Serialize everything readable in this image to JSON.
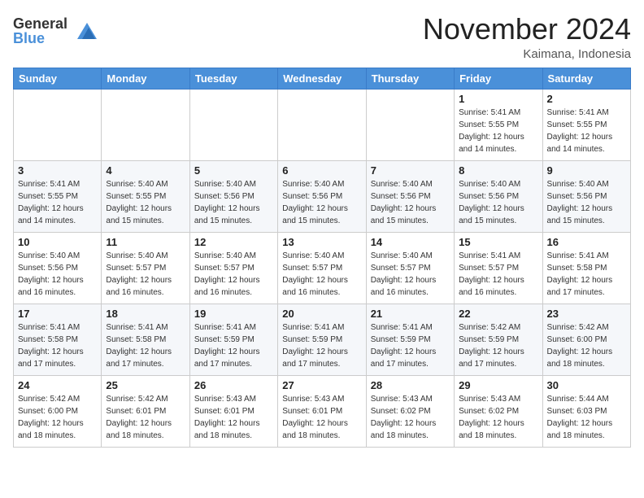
{
  "header": {
    "logo_general": "General",
    "logo_blue": "Blue",
    "month_title": "November 2024",
    "subtitle": "Kaimana, Indonesia"
  },
  "weekdays": [
    "Sunday",
    "Monday",
    "Tuesday",
    "Wednesday",
    "Thursday",
    "Friday",
    "Saturday"
  ],
  "weeks": [
    [
      {
        "day": "",
        "info": ""
      },
      {
        "day": "",
        "info": ""
      },
      {
        "day": "",
        "info": ""
      },
      {
        "day": "",
        "info": ""
      },
      {
        "day": "",
        "info": ""
      },
      {
        "day": "1",
        "info": "Sunrise: 5:41 AM\nSunset: 5:55 PM\nDaylight: 12 hours\nand 14 minutes."
      },
      {
        "day": "2",
        "info": "Sunrise: 5:41 AM\nSunset: 5:55 PM\nDaylight: 12 hours\nand 14 minutes."
      }
    ],
    [
      {
        "day": "3",
        "info": "Sunrise: 5:41 AM\nSunset: 5:55 PM\nDaylight: 12 hours\nand 14 minutes."
      },
      {
        "day": "4",
        "info": "Sunrise: 5:40 AM\nSunset: 5:55 PM\nDaylight: 12 hours\nand 15 minutes."
      },
      {
        "day": "5",
        "info": "Sunrise: 5:40 AM\nSunset: 5:56 PM\nDaylight: 12 hours\nand 15 minutes."
      },
      {
        "day": "6",
        "info": "Sunrise: 5:40 AM\nSunset: 5:56 PM\nDaylight: 12 hours\nand 15 minutes."
      },
      {
        "day": "7",
        "info": "Sunrise: 5:40 AM\nSunset: 5:56 PM\nDaylight: 12 hours\nand 15 minutes."
      },
      {
        "day": "8",
        "info": "Sunrise: 5:40 AM\nSunset: 5:56 PM\nDaylight: 12 hours\nand 15 minutes."
      },
      {
        "day": "9",
        "info": "Sunrise: 5:40 AM\nSunset: 5:56 PM\nDaylight: 12 hours\nand 15 minutes."
      }
    ],
    [
      {
        "day": "10",
        "info": "Sunrise: 5:40 AM\nSunset: 5:56 PM\nDaylight: 12 hours\nand 16 minutes."
      },
      {
        "day": "11",
        "info": "Sunrise: 5:40 AM\nSunset: 5:57 PM\nDaylight: 12 hours\nand 16 minutes."
      },
      {
        "day": "12",
        "info": "Sunrise: 5:40 AM\nSunset: 5:57 PM\nDaylight: 12 hours\nand 16 minutes."
      },
      {
        "day": "13",
        "info": "Sunrise: 5:40 AM\nSunset: 5:57 PM\nDaylight: 12 hours\nand 16 minutes."
      },
      {
        "day": "14",
        "info": "Sunrise: 5:40 AM\nSunset: 5:57 PM\nDaylight: 12 hours\nand 16 minutes."
      },
      {
        "day": "15",
        "info": "Sunrise: 5:41 AM\nSunset: 5:57 PM\nDaylight: 12 hours\nand 16 minutes."
      },
      {
        "day": "16",
        "info": "Sunrise: 5:41 AM\nSunset: 5:58 PM\nDaylight: 12 hours\nand 17 minutes."
      }
    ],
    [
      {
        "day": "17",
        "info": "Sunrise: 5:41 AM\nSunset: 5:58 PM\nDaylight: 12 hours\nand 17 minutes."
      },
      {
        "day": "18",
        "info": "Sunrise: 5:41 AM\nSunset: 5:58 PM\nDaylight: 12 hours\nand 17 minutes."
      },
      {
        "day": "19",
        "info": "Sunrise: 5:41 AM\nSunset: 5:59 PM\nDaylight: 12 hours\nand 17 minutes."
      },
      {
        "day": "20",
        "info": "Sunrise: 5:41 AM\nSunset: 5:59 PM\nDaylight: 12 hours\nand 17 minutes."
      },
      {
        "day": "21",
        "info": "Sunrise: 5:41 AM\nSunset: 5:59 PM\nDaylight: 12 hours\nand 17 minutes."
      },
      {
        "day": "22",
        "info": "Sunrise: 5:42 AM\nSunset: 5:59 PM\nDaylight: 12 hours\nand 17 minutes."
      },
      {
        "day": "23",
        "info": "Sunrise: 5:42 AM\nSunset: 6:00 PM\nDaylight: 12 hours\nand 18 minutes."
      }
    ],
    [
      {
        "day": "24",
        "info": "Sunrise: 5:42 AM\nSunset: 6:00 PM\nDaylight: 12 hours\nand 18 minutes."
      },
      {
        "day": "25",
        "info": "Sunrise: 5:42 AM\nSunset: 6:01 PM\nDaylight: 12 hours\nand 18 minutes."
      },
      {
        "day": "26",
        "info": "Sunrise: 5:43 AM\nSunset: 6:01 PM\nDaylight: 12 hours\nand 18 minutes."
      },
      {
        "day": "27",
        "info": "Sunrise: 5:43 AM\nSunset: 6:01 PM\nDaylight: 12 hours\nand 18 minutes."
      },
      {
        "day": "28",
        "info": "Sunrise: 5:43 AM\nSunset: 6:02 PM\nDaylight: 12 hours\nand 18 minutes."
      },
      {
        "day": "29",
        "info": "Sunrise: 5:43 AM\nSunset: 6:02 PM\nDaylight: 12 hours\nand 18 minutes."
      },
      {
        "day": "30",
        "info": "Sunrise: 5:44 AM\nSunset: 6:03 PM\nDaylight: 12 hours\nand 18 minutes."
      }
    ]
  ]
}
